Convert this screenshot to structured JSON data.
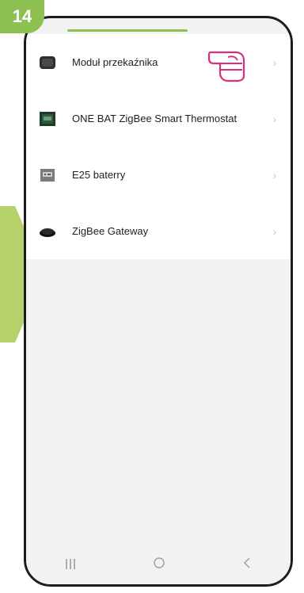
{
  "step_number": "14",
  "devices": [
    {
      "label": "Moduł przekaźnika",
      "icon": "relay-module-icon"
    },
    {
      "label": "ONE BAT ZigBee Smart Thermostat",
      "icon": "thermostat-icon"
    },
    {
      "label": "E25 baterry",
      "icon": "battery-sensor-icon"
    },
    {
      "label": "ZigBee Gateway",
      "icon": "gateway-icon"
    }
  ],
  "nav": {
    "recent_label": "III",
    "home_icon": "home-circle-icon",
    "back_icon": "back-chevron-icon"
  },
  "colors": {
    "accent_green": "#8cc152",
    "pointer_green": "#b6d06a",
    "hand_pink": "#d6317e",
    "frame": "#1d1d1d"
  }
}
